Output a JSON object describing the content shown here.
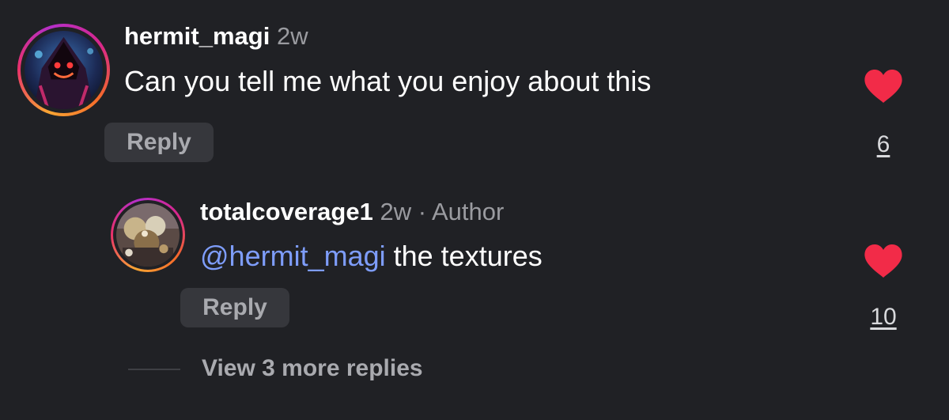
{
  "comments": [
    {
      "username": "hermit_magi",
      "time": "2w",
      "text": "Can you tell me what you enjoy about this",
      "reply_label": "Reply",
      "like_count": "6",
      "avatar_icon": "hooded-mage-avatar"
    },
    {
      "username": "totalcoverage1",
      "time": "2w",
      "separator": "·",
      "author_badge": "Author",
      "mention": "@hermit_magi",
      "text": " the textures",
      "reply_label": "Reply",
      "like_count": "10",
      "avatar_icon": "textured-collage-avatar"
    }
  ],
  "view_more_label": "View 3 more replies",
  "colors": {
    "background": "#202125",
    "heart": "#f22b48",
    "mention": "#7e9dfb",
    "muted": "#9a9ba0",
    "reply_button_bg": "#36373c"
  }
}
